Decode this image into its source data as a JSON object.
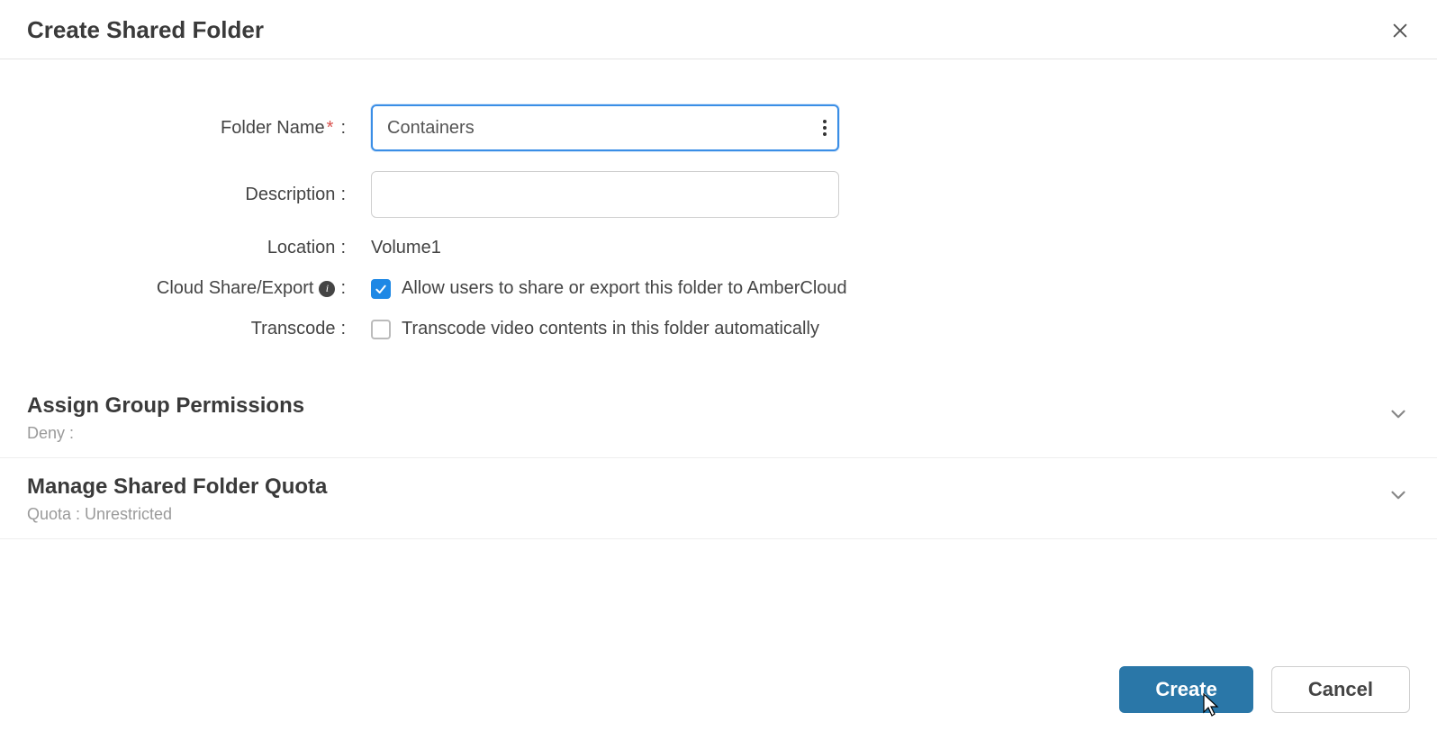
{
  "header": {
    "title": "Create Shared Folder"
  },
  "form": {
    "folderName": {
      "label": "Folder Name",
      "value": "Containers"
    },
    "description": {
      "label": "Description",
      "value": ""
    },
    "location": {
      "label": "Location",
      "value": "Volume1"
    },
    "cloudShare": {
      "label": "Cloud Share/Export",
      "text": "Allow users to share or export this folder to AmberCloud",
      "checked": true
    },
    "transcode": {
      "label": "Transcode",
      "text": "Transcode video contents in this folder automatically",
      "checked": false
    }
  },
  "sections": {
    "permissions": {
      "title": "Assign Group Permissions",
      "sub": "Deny :"
    },
    "quota": {
      "title": "Manage Shared Folder Quota",
      "sub": "Quota : Unrestricted"
    }
  },
  "footer": {
    "create": "Create",
    "cancel": "Cancel"
  }
}
